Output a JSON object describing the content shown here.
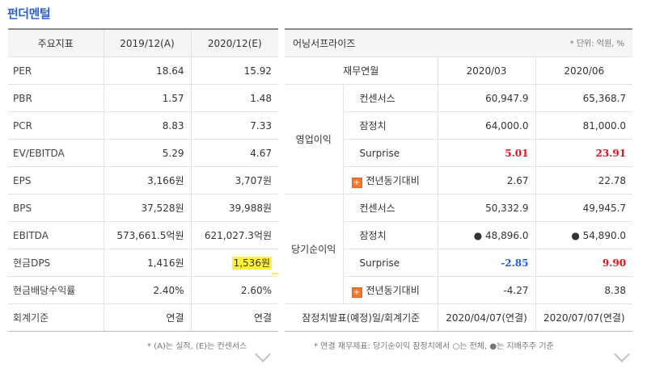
{
  "title": "펀더멘털",
  "fundamentals": {
    "headers": [
      "주요지표",
      "2019/12(A)",
      "2020/12(E)"
    ],
    "rows": [
      {
        "label": "PER",
        "a": "18.64",
        "e": "15.92"
      },
      {
        "label": "PBR",
        "a": "1.57",
        "e": "1.48"
      },
      {
        "label": "PCR",
        "a": "8.83",
        "e": "7.33"
      },
      {
        "label": "EV/EBITDA",
        "a": "5.29",
        "e": "4.67"
      },
      {
        "label": "EPS",
        "a": "3,166원",
        "e": "3,707원"
      },
      {
        "label": "BPS",
        "a": "37,528원",
        "e": "39,988원"
      },
      {
        "label": "EBITDA",
        "a": "573,661.5억원",
        "e": "621,027.3억원"
      },
      {
        "label": "현금DPS",
        "a": "1,416원",
        "e": "1,536원"
      },
      {
        "label": "현금배당수익률",
        "a": "2.40%",
        "e": "2.60%"
      },
      {
        "label": "회계기준",
        "a": "연결",
        "e": "연결"
      }
    ],
    "note": "* (A)는 실적, (E)는 컨센서스"
  },
  "earnings": {
    "title": "어닝서프라이즈",
    "unit": "* 단위: 억원, %",
    "col_label": "재무연월",
    "periods": [
      "2020/03",
      "2020/06"
    ],
    "op": {
      "group": "영업이익",
      "consensus": {
        "label": "컨센서스",
        "v1": "60,947.9",
        "v2": "65,368.7"
      },
      "provisional": {
        "label": "잠정치",
        "v1": "64,000.0",
        "v2": "81,000.0"
      },
      "surprise": {
        "label": "Surprise",
        "v1": "5.01",
        "v2": "23.91"
      },
      "yoy": {
        "label": "전년동기대비",
        "v1": "2.67",
        "v2": "22.78"
      }
    },
    "net": {
      "group": "당기순이익",
      "consensus": {
        "label": "컨센서스",
        "v1": "50,332.9",
        "v2": "49,945.7"
      },
      "provisional": {
        "label": "잠정치",
        "v1": "● 48,896.0",
        "v2": "● 54,890.0"
      },
      "surprise": {
        "label": "Surprise",
        "v1": "-2.85",
        "v2": "9.90"
      },
      "yoy": {
        "label": "전년동기대비",
        "v1": "-4.27",
        "v2": "8.38"
      }
    },
    "release": {
      "label": "잠정치발표(예정)일/회계기준",
      "v1": "2020/04/07(연결)",
      "v2": "2020/07/07(연결)"
    },
    "note": "* 연결 재무제표: 당기순이익 잠정치에서 ○는 전체, ●는 지배주주 기준"
  },
  "colors": {
    "accent": "#2f62c7",
    "positive": "#e0141e",
    "negative": "#1f5fdc",
    "highlight": "#fff23a"
  },
  "icons": {
    "expand": "chevron-down-icon",
    "plus": "plus-box-icon"
  }
}
